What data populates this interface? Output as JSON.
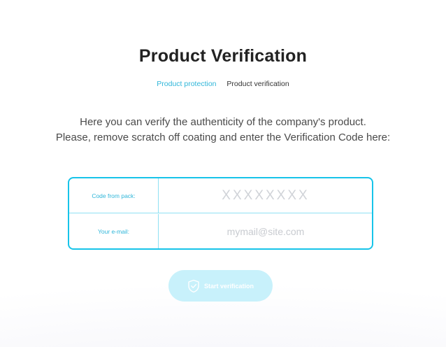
{
  "page": {
    "title": "Product Verification"
  },
  "breadcrumb": {
    "items": [
      {
        "label": "Product protection",
        "link": true
      },
      {
        "label": "Product verification",
        "link": false
      }
    ]
  },
  "description": {
    "line1": "Here you can verify the authenticity of the company's product.",
    "line2": "Please, remove scratch off coating and enter the Verification Code here:"
  },
  "form": {
    "code": {
      "label": "Code from pack:",
      "placeholder": "XXXXXXXX",
      "value": ""
    },
    "email": {
      "label": "Your e-mail:",
      "placeholder": "mymail@site.com",
      "value": ""
    }
  },
  "button": {
    "label": "Start verification",
    "icon": "shield-check-icon"
  },
  "colors": {
    "accent": "#17c4e9",
    "link": "#2fb6d9",
    "button_bg": "#c8f1fb"
  }
}
